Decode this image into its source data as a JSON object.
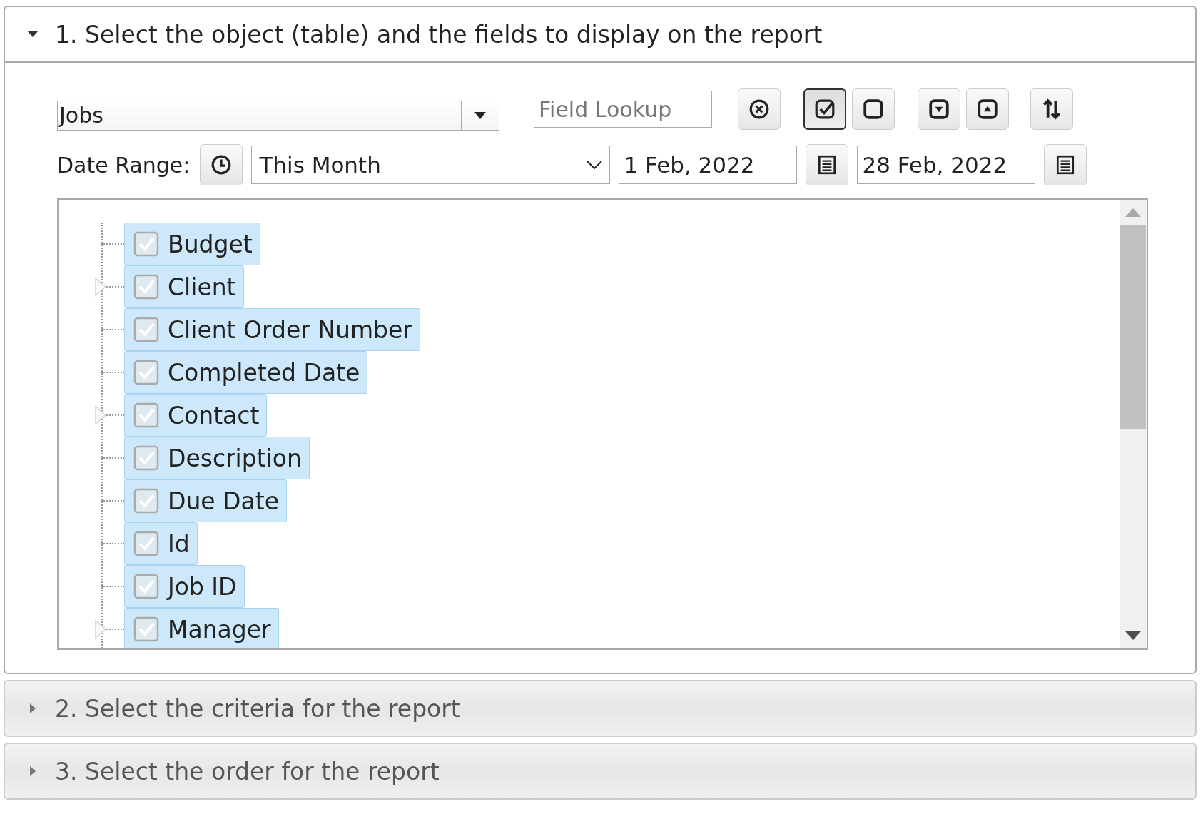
{
  "sections": [
    {
      "kind": "fields",
      "title": "1. Select the object (table) and the fields to display on the report",
      "expanded": true
    },
    {
      "kind": "criteria",
      "title": "2. Select the criteria for the report",
      "expanded": false
    },
    {
      "kind": "order",
      "title": "3. Select the order for the report",
      "expanded": false
    }
  ],
  "object_select": {
    "value": "Jobs"
  },
  "field_lookup": {
    "placeholder": "Field Lookup"
  },
  "toolbar_buttons": [
    {
      "kind": "clear",
      "pressed": false
    },
    {
      "kind": "check-all",
      "pressed": true
    },
    {
      "kind": "uncheck-all",
      "pressed": false
    },
    {
      "kind": "expand-all",
      "pressed": false
    },
    {
      "kind": "collapse-all",
      "pressed": false
    },
    {
      "kind": "sort",
      "pressed": false
    }
  ],
  "date_range": {
    "label": "Date Range:",
    "preset": "This Month",
    "from": "1 Feb, 2022",
    "to": "28 Feb, 2022"
  },
  "fields": [
    {
      "label": "Budget",
      "checked": true,
      "selected": true,
      "expandable": false
    },
    {
      "label": "Client",
      "checked": true,
      "selected": true,
      "expandable": true
    },
    {
      "label": "Client Order Number",
      "checked": true,
      "selected": true,
      "expandable": false
    },
    {
      "label": "Completed Date",
      "checked": true,
      "selected": true,
      "expandable": false
    },
    {
      "label": "Contact",
      "checked": true,
      "selected": true,
      "expandable": true
    },
    {
      "label": "Description",
      "checked": true,
      "selected": true,
      "expandable": false
    },
    {
      "label": "Due Date",
      "checked": true,
      "selected": true,
      "expandable": false
    },
    {
      "label": "Id",
      "checked": true,
      "selected": true,
      "expandable": false
    },
    {
      "label": "Job ID",
      "checked": true,
      "selected": true,
      "expandable": false
    },
    {
      "label": "Manager",
      "checked": true,
      "selected": true,
      "expandable": true
    }
  ]
}
